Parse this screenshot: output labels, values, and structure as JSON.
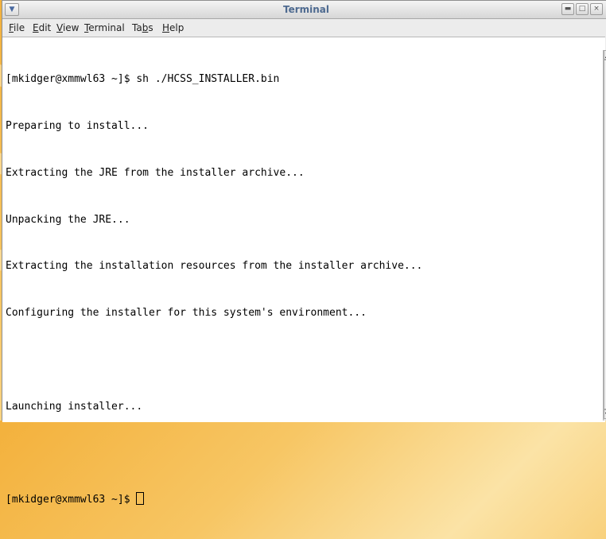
{
  "window": {
    "title": "Terminal",
    "buttons": {
      "minimize": "▬",
      "maximize": "□",
      "close": "×"
    },
    "menu_icon": "chevron-down-icon"
  },
  "menubar": {
    "items": [
      {
        "label": "File",
        "mnemonic": "F"
      },
      {
        "label": "Edit",
        "mnemonic": "E"
      },
      {
        "label": "View",
        "mnemonic": "V"
      },
      {
        "label": "Terminal",
        "mnemonic": "T"
      },
      {
        "label": "Tabs",
        "mnemonic": "b"
      },
      {
        "label": "Help",
        "mnemonic": "H"
      }
    ]
  },
  "terminal": {
    "lines": [
      "[mkidger@xmmwl63 ~]$ sh ./HCSS_INSTALLER.bin",
      "Preparing to install...",
      "Extracting the JRE from the installer archive...",
      "Unpacking the JRE...",
      "Extracting the installation resources from the installer archive...",
      "Configuring the installer for this system's environment...",
      "",
      "Launching installer...",
      ""
    ],
    "prompt": "[mkidger@xmmwl63 ~]$ "
  },
  "colors": {
    "title_text": "#4e6a90",
    "terminal_bg": "#ffffff",
    "terminal_fg": "#000000"
  }
}
